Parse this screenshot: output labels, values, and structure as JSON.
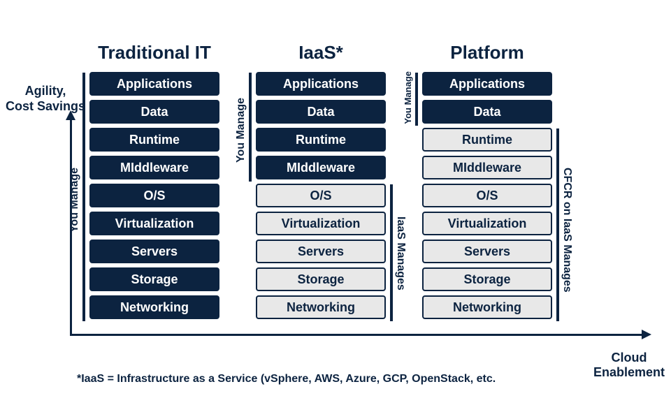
{
  "axes": {
    "y_label_line1": "Agility,",
    "y_label_line2": "Cost Savings",
    "x_label_line1": "Cloud",
    "x_label_line2": "Enablement"
  },
  "columns": [
    {
      "title": "Traditional IT",
      "brackets": {
        "left_you": "You Manage"
      },
      "layers": [
        {
          "label": "Applications",
          "owner": "you"
        },
        {
          "label": "Data",
          "owner": "you"
        },
        {
          "label": "Runtime",
          "owner": "you"
        },
        {
          "label": "MIddleware",
          "owner": "you"
        },
        {
          "label": "O/S",
          "owner": "you"
        },
        {
          "label": "Virtualization",
          "owner": "you"
        },
        {
          "label": "Servers",
          "owner": "you"
        },
        {
          "label": "Storage",
          "owner": "you"
        },
        {
          "label": "Networking",
          "owner": "you"
        }
      ]
    },
    {
      "title": "IaaS*",
      "brackets": {
        "left_you": "You Manage",
        "right_provider": "IaaS Manages"
      },
      "layers": [
        {
          "label": "Applications",
          "owner": "you"
        },
        {
          "label": "Data",
          "owner": "you"
        },
        {
          "label": "Runtime",
          "owner": "you"
        },
        {
          "label": "MIddleware",
          "owner": "you"
        },
        {
          "label": "O/S",
          "owner": "provider"
        },
        {
          "label": "Virtualization",
          "owner": "provider"
        },
        {
          "label": "Servers",
          "owner": "provider"
        },
        {
          "label": "Storage",
          "owner": "provider"
        },
        {
          "label": "Networking",
          "owner": "provider"
        }
      ]
    },
    {
      "title": "Platform",
      "brackets": {
        "left_you": "You Manage",
        "right_provider": "CFCR on IaaS Manages"
      },
      "layers": [
        {
          "label": "Applications",
          "owner": "you"
        },
        {
          "label": "Data",
          "owner": "you"
        },
        {
          "label": "Runtime",
          "owner": "provider"
        },
        {
          "label": "MIddleware",
          "owner": "provider"
        },
        {
          "label": "O/S",
          "owner": "provider"
        },
        {
          "label": "Virtualization",
          "owner": "provider"
        },
        {
          "label": "Servers",
          "owner": "provider"
        },
        {
          "label": "Storage",
          "owner": "provider"
        },
        {
          "label": "Networking",
          "owner": "provider"
        }
      ]
    }
  ],
  "footnote": "*IaaS = Infrastructure as a Service (vSphere, AWS, Azure, GCP, OpenStack, etc."
}
